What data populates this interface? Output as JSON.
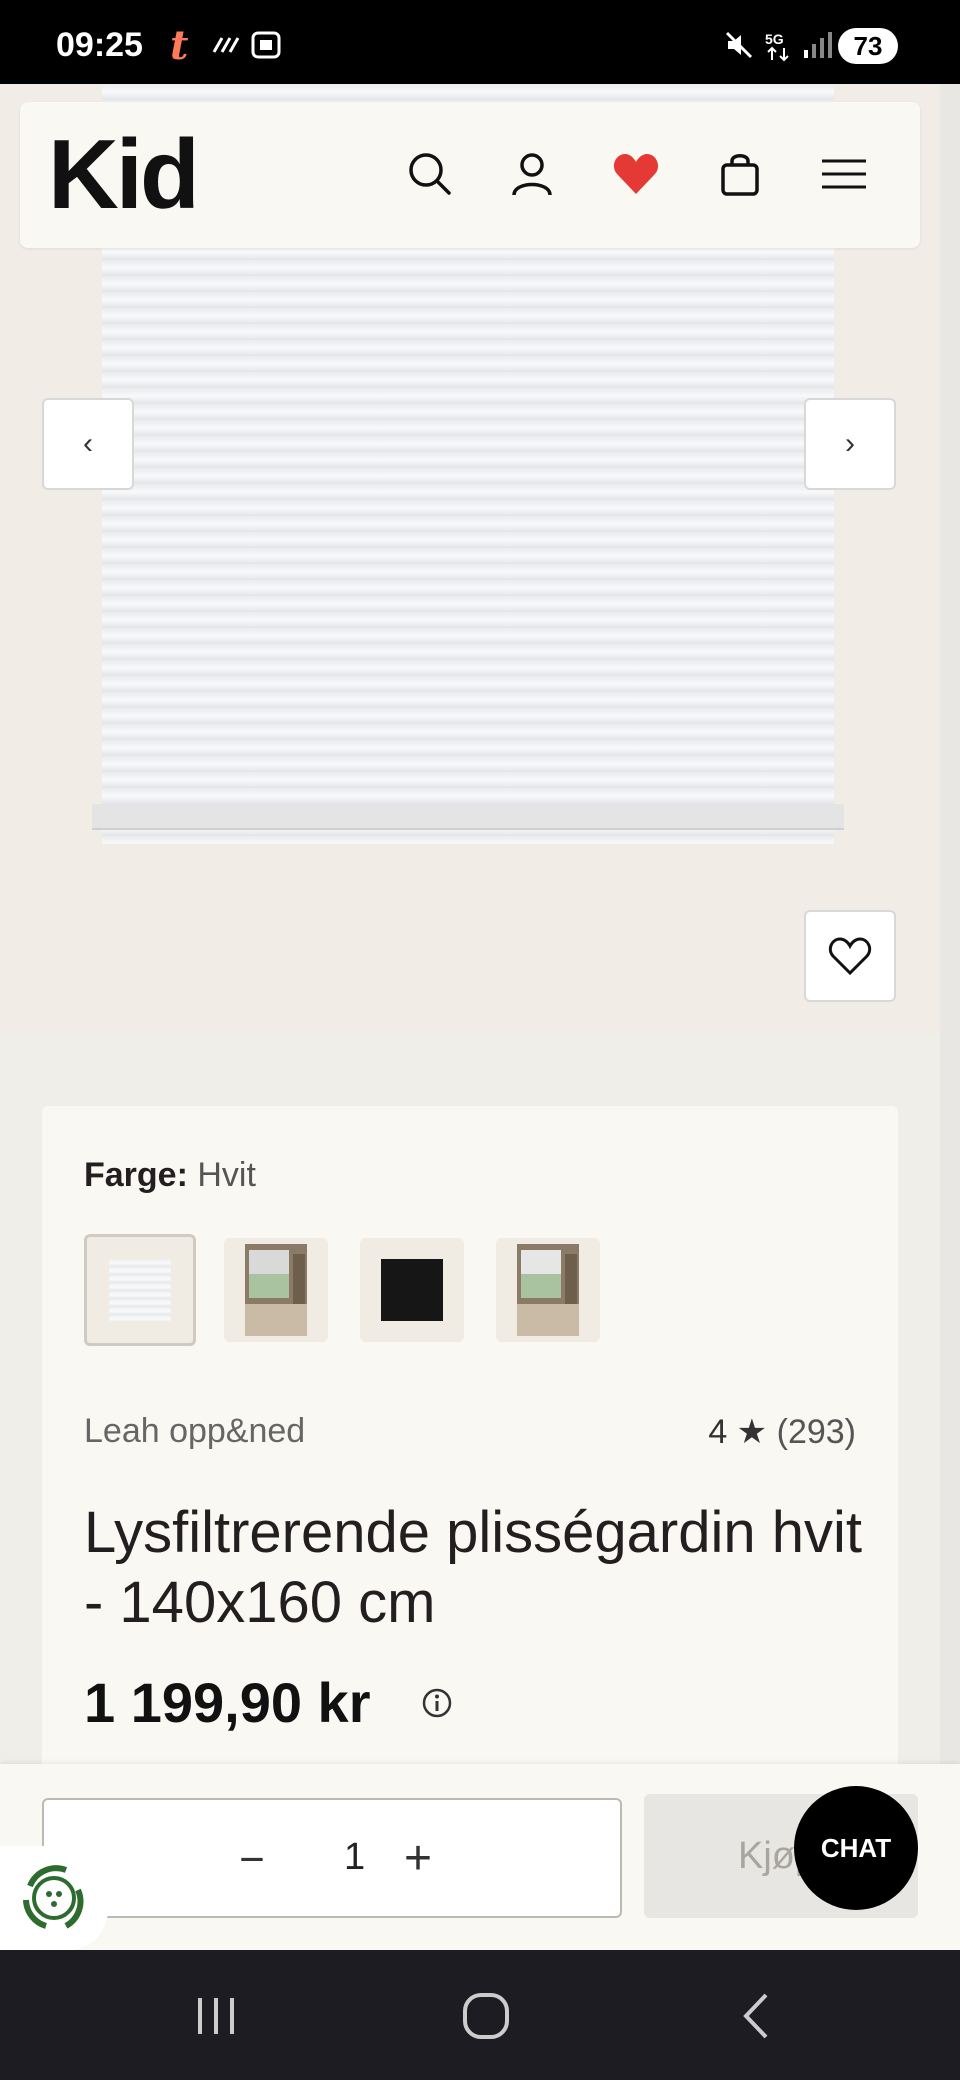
{
  "status_bar": {
    "time": "09:25",
    "app_icon_letter": "t",
    "battery": "73",
    "icons": [
      "signal-icon",
      "screenshot-icon",
      "mute-icon",
      "5g-icon",
      "cell-signal-icon"
    ]
  },
  "header": {
    "logo": "Kid",
    "icons": [
      "search-icon",
      "account-icon",
      "favorites-heart-icon",
      "shopping-bag-icon",
      "menu-icon"
    ],
    "heart_color": "#e53935"
  },
  "carousel": {
    "prev_label": "‹",
    "next_label": "›"
  },
  "product": {
    "color_label": "Farge:",
    "color_value": "Hvit",
    "swatches": [
      "white-blind",
      "room-with-blind",
      "black-blind",
      "room-with-blind-2"
    ],
    "brand": "Leah opp&ned",
    "rating": "4 ★",
    "review_count": "(293)",
    "title": "Lysfiltrerende plisségardin hvit - 140x160 cm",
    "price": "1 199,90 kr"
  },
  "purchase": {
    "minus": "−",
    "quantity": "1",
    "plus": "+",
    "buy_label": "Kjøp",
    "chat_label": "CHAT"
  },
  "nav": {
    "icons": [
      "recent-apps-icon",
      "home-icon",
      "back-icon"
    ]
  }
}
